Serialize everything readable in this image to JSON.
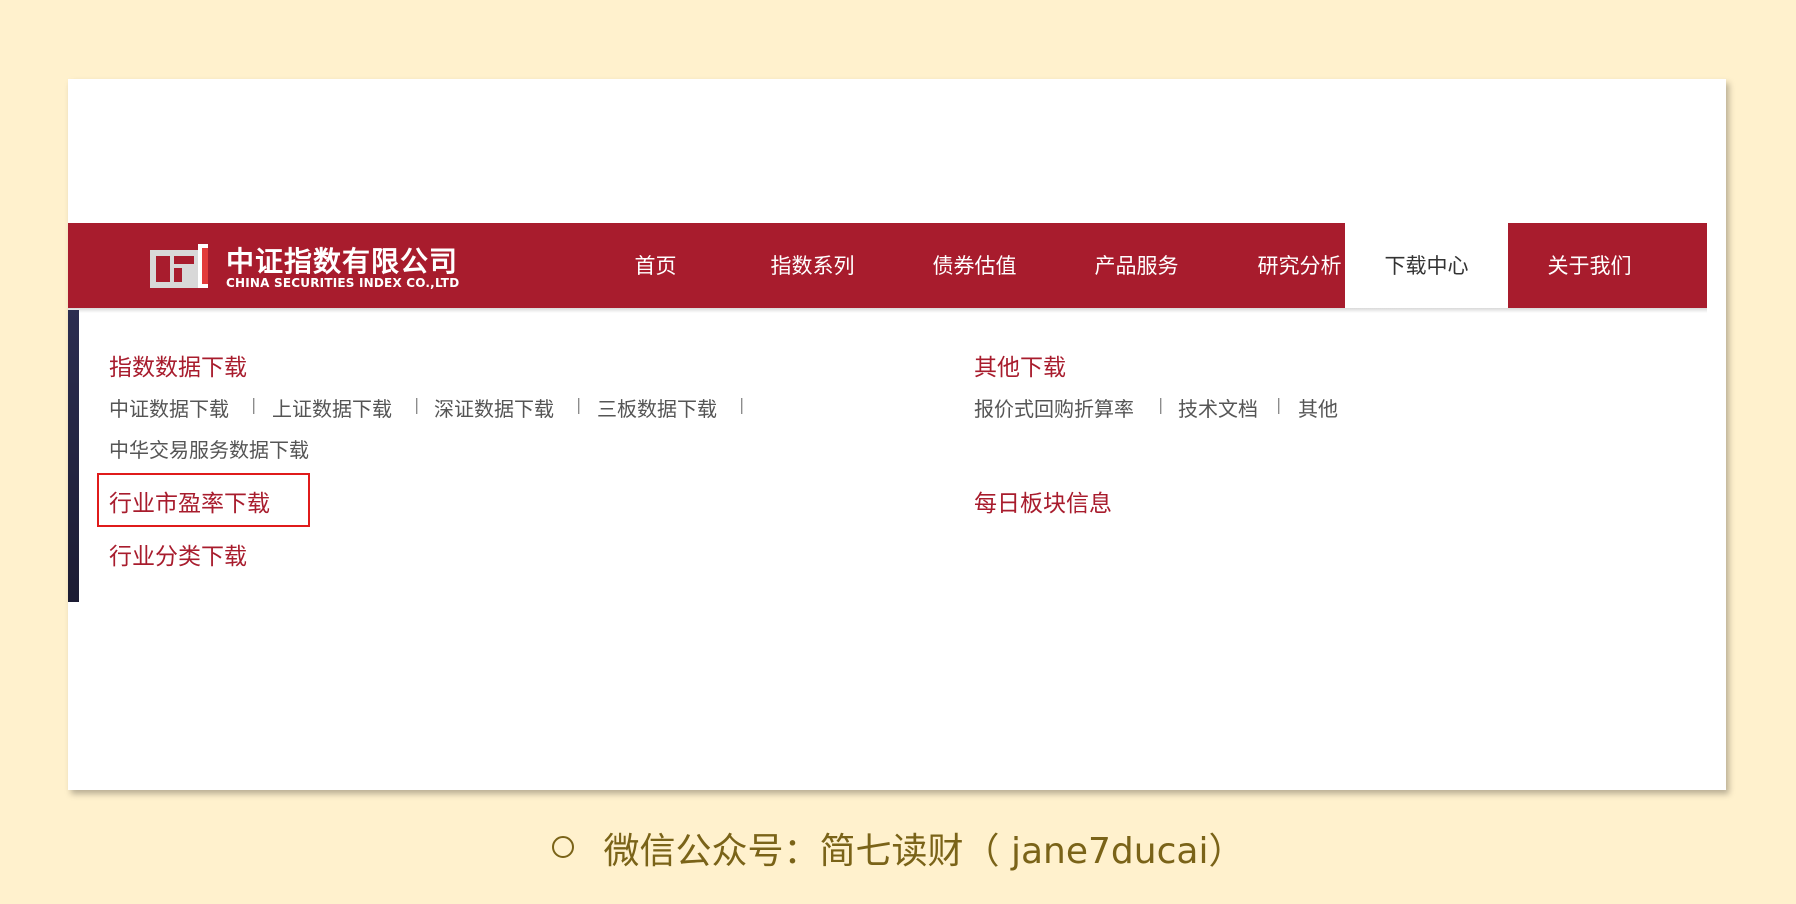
{
  "logo": {
    "name_cn": "中证指数有限公司",
    "name_en": "CHINA SECURITIES INDEX CO.,LTD"
  },
  "nav": {
    "items": [
      {
        "label": "首页"
      },
      {
        "label": "指数系列"
      },
      {
        "label": "债券估值"
      },
      {
        "label": "产品服务"
      },
      {
        "label": "研究分析"
      },
      {
        "label": "下载中心",
        "active": true
      },
      {
        "label": "关于我们"
      }
    ]
  },
  "dropdown": {
    "left": {
      "title": "指数数据下载",
      "links": [
        "中证数据下载",
        "上证数据下载",
        "深证数据下载",
        "三板数据下载",
        "中华交易服务数据下载"
      ],
      "pe_title": "行业市盈率下载",
      "class_title": "行业分类下载"
    },
    "right": {
      "title": "其他下载",
      "links": [
        "报价式回购折算率",
        "技术文档",
        "其他"
      ],
      "daily_title": "每日板块信息"
    },
    "separator": "|"
  },
  "caption": {
    "text": "微信公众号：简七读财（ jane7ducai）"
  },
  "colors": {
    "brand_red": "#a81c2d",
    "background": "#fff1cd",
    "highlight_box": "#e01b1b",
    "caption": "#7a6318"
  }
}
